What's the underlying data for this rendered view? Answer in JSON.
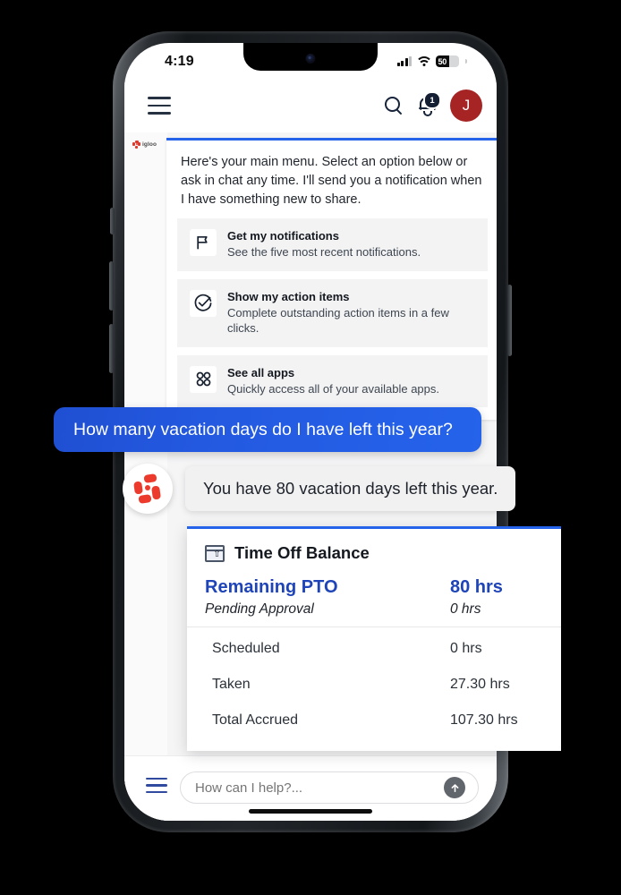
{
  "status_bar": {
    "time": "4:19",
    "battery_percent": "50",
    "signal_icon": "cellular-signal-icon",
    "wifi_icon": "wifi-icon",
    "battery_icon": "battery-icon"
  },
  "header": {
    "menu_icon": "hamburger-menu-icon",
    "search_icon": "search-icon",
    "notifications_icon": "bell-icon",
    "notification_count": "1",
    "avatar_initial": "J"
  },
  "brand": {
    "name": "igloo",
    "logo_icon": "igloo-logo-icon"
  },
  "menu_card": {
    "intro": "Here's your main menu. Select an option below or ask in chat any time. I'll send you a notification when I have something new to share.",
    "accent_color": "#2563eb",
    "items": [
      {
        "icon": "flag-icon",
        "title": "Get my notifications",
        "description": "See the five most recent notifications."
      },
      {
        "icon": "check-circle-icon",
        "title": "Show my action items",
        "description": "Complete outstanding action items in a few clicks."
      },
      {
        "icon": "apps-grid-icon",
        "title": "See all apps",
        "description": "Quickly access all of your available apps."
      }
    ]
  },
  "conversation": {
    "user_message": "How many vacation days do I have left this year?",
    "user_bubble_color": "#2563eb",
    "bot_avatar_icon": "igloo-bot-avatar-icon",
    "bot_message": "You have 80 vacation days left this year."
  },
  "time_off_card": {
    "icon": "window-upload-icon",
    "title": "Time Off Balance",
    "accent_color": "#2563eb",
    "primary": {
      "label": "Remaining PTO",
      "value": "80 hrs"
    },
    "pending": {
      "label": "Pending Approval",
      "value": "0 hrs"
    },
    "rows": [
      {
        "label": "Scheduled",
        "value": "0 hrs"
      },
      {
        "label": "Taken",
        "value": "27.30 hrs"
      },
      {
        "label": "Total Accrued",
        "value": "107.30 hrs"
      }
    ]
  },
  "composer": {
    "menu_icon": "hamburger-menu-icon",
    "placeholder": "How can I help?...",
    "value": "",
    "send_icon": "arrow-up-icon"
  }
}
